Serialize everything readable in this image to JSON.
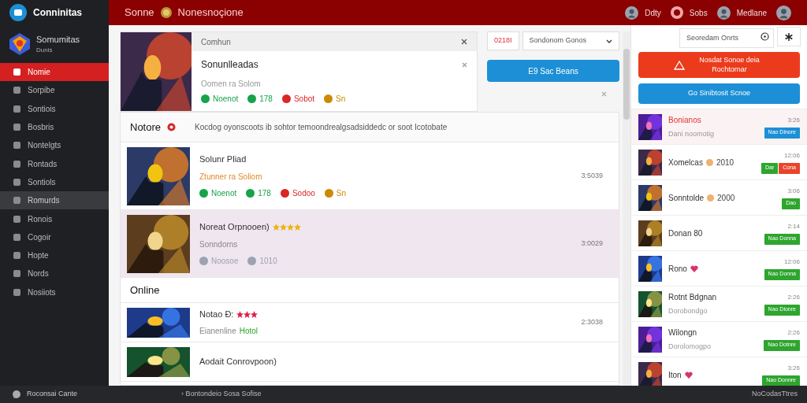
{
  "topbar": {
    "app_name": "Conninitas",
    "title_left": "Sonne",
    "title_right": "Nonesnoçione",
    "users": [
      {
        "kind": "avatar",
        "name": "Ddty"
      },
      {
        "kind": "icon",
        "name": "Sobs"
      },
      {
        "kind": "avatar",
        "name": "Medlane"
      }
    ]
  },
  "sidebar": {
    "brand": "Somumitas",
    "brand_sub": "Dunis",
    "items": [
      {
        "label": "Nomie",
        "selected": true,
        "hovered": false
      },
      {
        "label": "Sorpibe",
        "selected": false,
        "hovered": false
      },
      {
        "label": "Sontiois",
        "selected": false,
        "hovered": false
      },
      {
        "label": "Bosbris",
        "selected": false,
        "hovered": false
      },
      {
        "label": "Nontelgts",
        "selected": false,
        "hovered": false
      },
      {
        "label": "Rontads",
        "selected": false,
        "hovered": false
      },
      {
        "label": "Sontiols",
        "selected": false,
        "hovered": false
      },
      {
        "label": "Romurds",
        "selected": false,
        "hovered": true
      },
      {
        "label": "Ronois",
        "selected": false,
        "hovered": false
      },
      {
        "label": "Cogoir",
        "selected": false,
        "hovered": false
      },
      {
        "label": "Hopte",
        "selected": false,
        "hovered": false
      },
      {
        "label": "Nords",
        "selected": false,
        "hovered": false
      },
      {
        "label": "Nosiiots",
        "selected": false,
        "hovered": false
      }
    ]
  },
  "feature": {
    "header": "Comhun",
    "title": "Sonunlleadas",
    "subtitle": "Oomen ra Solom",
    "meta": [
      {
        "text": "Noenot",
        "color": "#16a34a"
      },
      {
        "text": "178",
        "color": "#16a34a"
      },
      {
        "text": "Sobot",
        "color": "#dc2626"
      },
      {
        "text": "Sn",
        "color": "#ca8a04"
      }
    ]
  },
  "controls": {
    "code_field": "0218I",
    "dropdown": "Sondonom Gonos",
    "button": "E9 Sac Beans"
  },
  "notice": {
    "title": "Notore",
    "text": "Kocdog oyonscoots ib sohtor temoondrealgsadsiddedc or soot Icotobate"
  },
  "sections": [
    {
      "items": [
        {
          "title": "Solunr Pliad",
          "subtitle": "Ztunner ra Soliom",
          "subtitle_accent": true,
          "time": "3:5039",
          "selected": false,
          "meta": [
            {
              "text": "Noenot",
              "color": "#16a34a"
            },
            {
              "text": "178",
              "color": "#16a34a"
            },
            {
              "text": "Sodoo",
              "color": "#dc2626"
            },
            {
              "text": "Sn",
              "color": "#ca8a04"
            }
          ]
        },
        {
          "title": "Noreat Orpnooen)",
          "subtitle": "Sonndorns",
          "subtitle_accent": false,
          "stars": 4,
          "color": "#eab308",
          "time": "3:0029",
          "selected": true,
          "meta": [
            {
              "text": "Noosoe",
              "color": "#9ca3af"
            },
            {
              "text": "1010",
              "color": "#9ca3af"
            }
          ]
        }
      ]
    },
    {
      "title": "Online",
      "items": [
        {
          "title": "Notao Ð:",
          "stars": 3,
          "color": "#e11d48",
          "subtitle": "Eianenline",
          "tag": "Hotol",
          "subtitle_accent": false,
          "time": "2:3038",
          "selected": false
        },
        {
          "title": "Aodait Conrovpoon)",
          "selected": false
        }
      ]
    }
  ],
  "right": {
    "search": {
      "placeholder": "Seoredam Onrts"
    },
    "alert_button": "Nosdat Sonoe deia Rochtornar",
    "blue_button": "Go Sinibtosit Scnoe",
    "friends": [
      {
        "name": "Bonianos",
        "subtitle": "Dani noomotig",
        "time": "3:26",
        "selected": true,
        "buttons": [
          {
            "label": "Nao Dinore",
            "color": "#1d8fd6"
          }
        ]
      },
      {
        "name": "Xomelcas",
        "extra": "2010",
        "time": "12:06",
        "selected": false,
        "buttons": [
          {
            "label": "Dar",
            "color": "#2ea52e"
          },
          {
            "label": "Cona",
            "color": "#e8452c"
          }
        ]
      },
      {
        "name": "Sonntolde",
        "extra": "2000",
        "time": "3:06",
        "selected": false,
        "buttons": [
          {
            "label": "Dao",
            "color": "#2ea52e"
          }
        ]
      },
      {
        "name": "Donan 80",
        "time": "2:14",
        "selected": false,
        "buttons": [
          {
            "label": "Nao Donna",
            "color": "#2ea52e"
          }
        ]
      },
      {
        "name": "Rono",
        "heart": true,
        "time": "12:06",
        "selected": false,
        "buttons": [
          {
            "label": "Nao Donna",
            "color": "#2ea52e"
          }
        ]
      },
      {
        "name": "Rotnt Bdgnan",
        "subtitle": "Dorobondgo",
        "time": "2:26",
        "selected": false,
        "buttons": [
          {
            "label": "Nao Dionre",
            "color": "#2ea52e"
          }
        ]
      },
      {
        "name": "Wilongn",
        "subtitle": "Dorolomogpo",
        "time": "2:26",
        "selected": false,
        "buttons": [
          {
            "label": "Nao Dotnre",
            "color": "#2ea52e"
          }
        ]
      },
      {
        "name": "Iton",
        "heart": true,
        "time": "3:26",
        "selected": false,
        "buttons": [
          {
            "label": "Nao Donnre",
            "color": "#2ea52e"
          }
        ]
      }
    ]
  },
  "footer": {
    "left": "Roconsai Cante",
    "middle": "› Bontondeio Sosa Sofise",
    "right": "NoCodasTtres"
  }
}
